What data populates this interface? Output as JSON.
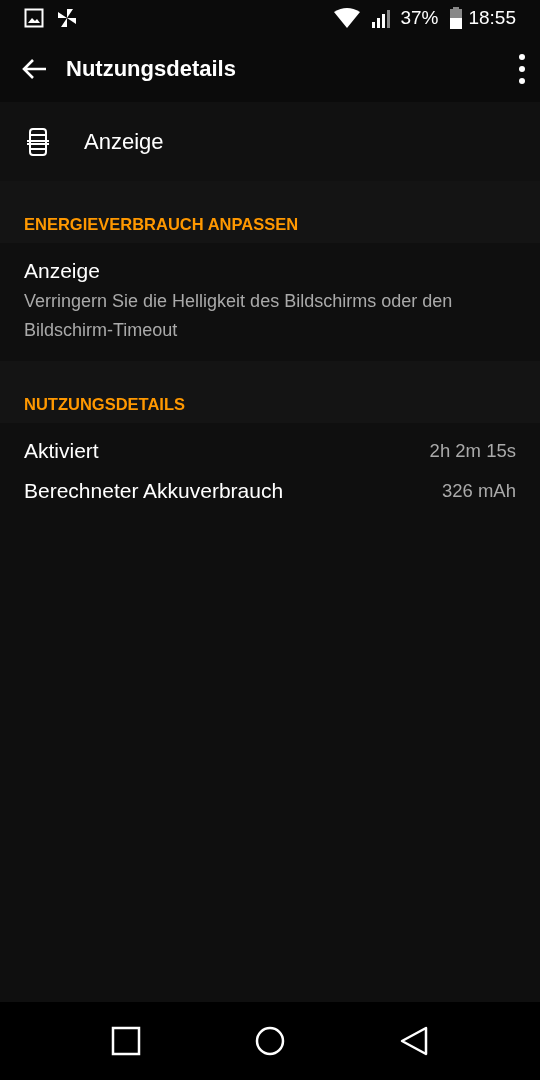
{
  "status_bar": {
    "battery": "37%",
    "time": "18:55"
  },
  "app_bar": {
    "title": "Nutzungsdetails"
  },
  "app_header": {
    "label": "Anzeige"
  },
  "sections": [
    {
      "title": "ENERGIEVERBRAUCH ANPASSEN",
      "items": [
        {
          "kind": "suggestion",
          "title": "Anzeige",
          "summary": "Verringern Sie die Helligkeit des Bildschirms oder den Bildschirm-Timeout"
        }
      ]
    },
    {
      "title": "NUTZUNGSDETAILS",
      "items": [
        {
          "kind": "detail",
          "title": "Aktiviert",
          "value": "2h 2m 15s"
        },
        {
          "kind": "detail",
          "title": "Berechneter Akkuverbrauch",
          "value": "326 mAh"
        }
      ]
    }
  ]
}
